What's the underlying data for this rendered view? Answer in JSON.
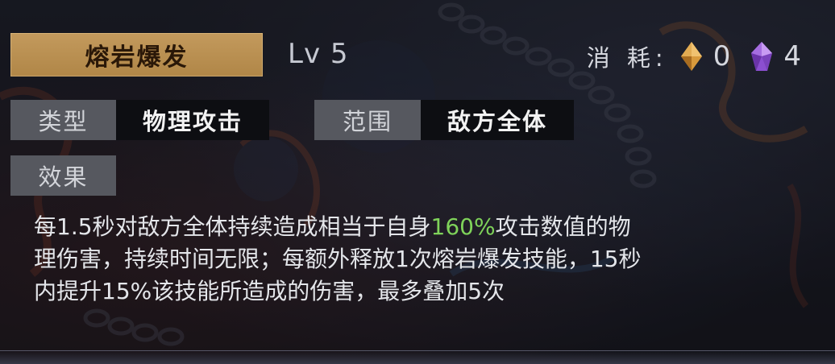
{
  "skill": {
    "name": "熔岩爆发",
    "level": "Lv 5"
  },
  "cost": {
    "label": "消 耗:",
    "items": [
      {
        "icon": "orange-diamond-gem-icon",
        "value": "0",
        "color": "#d89a3c"
      },
      {
        "icon": "purple-crystal-gem-icon",
        "value": "4",
        "color": "#a56de0"
      }
    ]
  },
  "tags": {
    "type_label": "类型",
    "type_value": "物理攻击",
    "range_label": "范围",
    "range_value": "敌方全体",
    "effect_label": "效果"
  },
  "description": {
    "line1_before": "每1.5秒对敌方全体持续造成相当于自身",
    "line1_highlight": "160%",
    "line1_after": "攻击数值的物",
    "line2": "理伤害，持续时间无限；每额外释放1次熔岩爆发技能，15秒",
    "line3": "内提升15%该技能所造成的伤害，最多叠加5次",
    "highlight_color": "#7fd35a"
  }
}
